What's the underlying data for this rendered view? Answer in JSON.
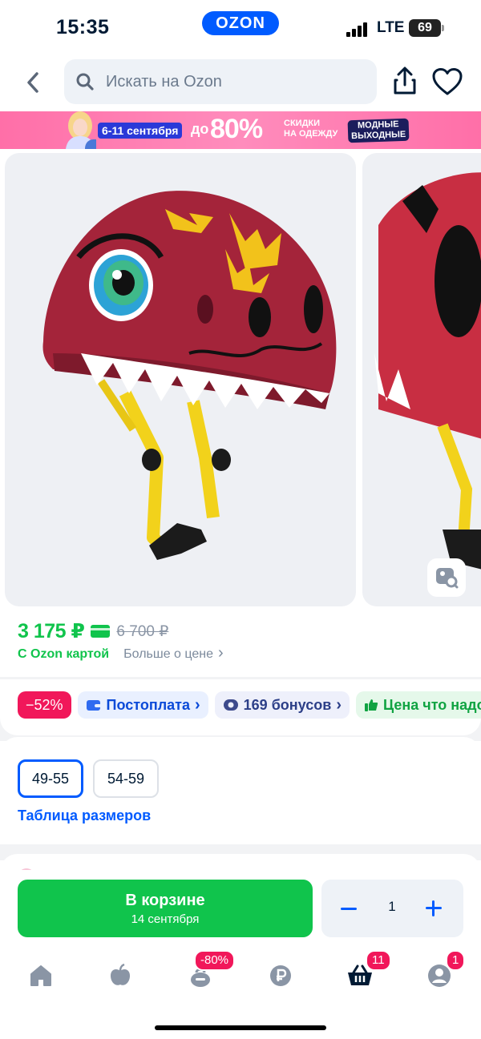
{
  "status_bar": {
    "time": "15:35",
    "app_badge": "OZON",
    "network": "LTE",
    "battery": "69"
  },
  "header": {
    "search_placeholder": "Искать на Ozon"
  },
  "promo_banner": {
    "dates": "6-11 сентября",
    "prefix": "до",
    "percent": "80%",
    "subtitle_line1": "СКИДКИ",
    "subtitle_line2": "НА ОДЕЖДУ",
    "tag_line1": "МОДНЫЕ",
    "tag_line2": "ВЫХОДНЫЕ"
  },
  "product": {
    "price": "3 175 ₽",
    "old_price": "6 700 ₽",
    "with_card_label": "С Ozon картой",
    "more_price_link": "Больше о цене"
  },
  "chips": {
    "discount": "−52%",
    "postpay": "Постоплата",
    "bonuses": "169 бонусов",
    "price_note": "Цена что надо"
  },
  "sizes": {
    "options": [
      "49-55",
      "54-59"
    ],
    "selected": "49-55",
    "table_link": "Таблица размеров"
  },
  "cart": {
    "button_title": "В корзине",
    "button_subtitle": "14 сентября",
    "quantity": "1"
  },
  "bottom_nav": {
    "items": [
      "home",
      "fresh",
      "discounts",
      "finance",
      "cart",
      "profile"
    ],
    "discount_badge": "-80%",
    "cart_badge": "11",
    "profile_badge": "1"
  },
  "colors": {
    "ozon_blue": "#005bff",
    "price_green": "#10c44c",
    "badge_pink": "#f1175a"
  }
}
